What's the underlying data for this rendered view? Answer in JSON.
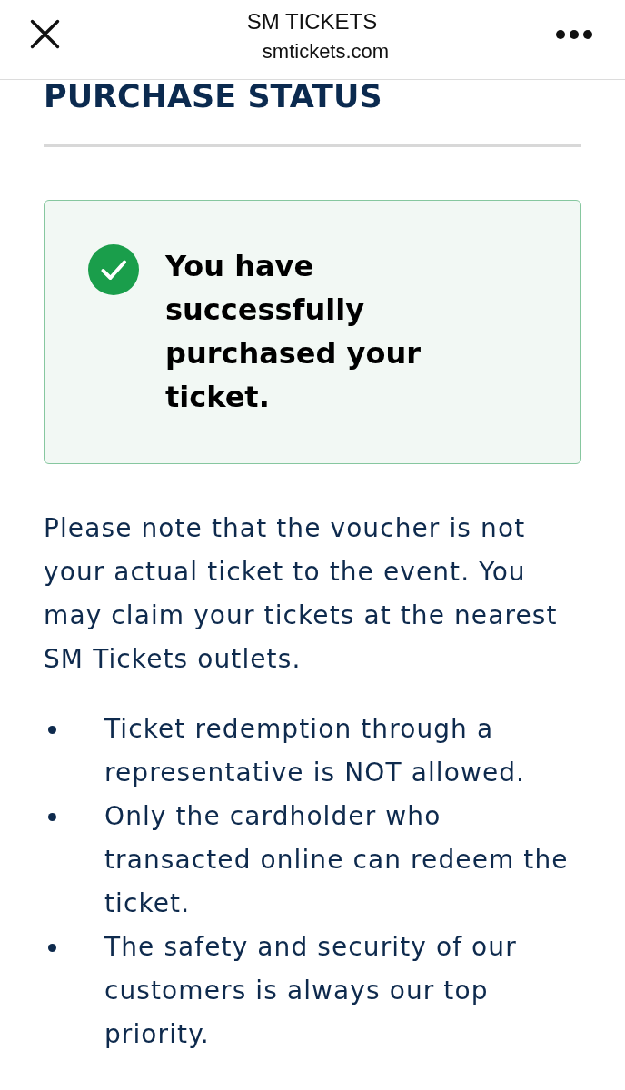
{
  "browser_bar": {
    "title": "SM TICKETS",
    "url": "smtickets.com"
  },
  "page": {
    "heading": "PURCHASE STATUS",
    "status": {
      "kind": "success",
      "message": "You have successfully purchased your ticket."
    },
    "note": "Please note that the voucher is not your actual ticket to the event. You may claim your tickets at the nearest SM Tickets outlets.",
    "bullets": [
      "Ticket redemption through a representative is NOT allowed.",
      "Only the cardholder who transacted online can redeem the ticket.",
      "The safety and security of our customers is always our top priority."
    ]
  }
}
